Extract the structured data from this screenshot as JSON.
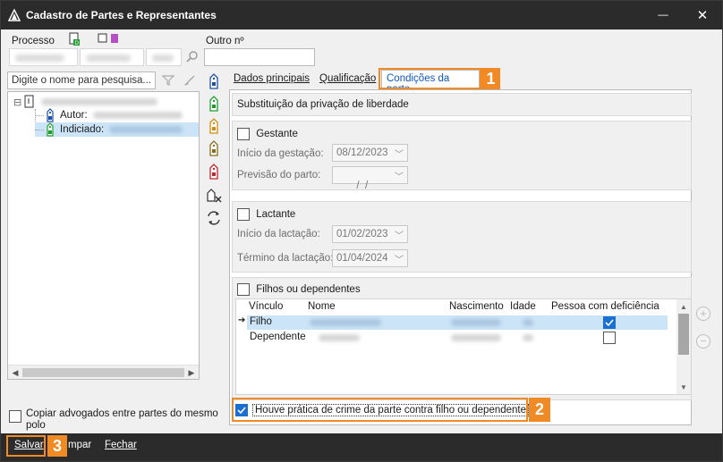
{
  "window": {
    "title": "Cadastro de Partes e Representantes",
    "minimize_glyph": "—",
    "close_glyph": "✕"
  },
  "process": {
    "processo_label": "Processo",
    "outro_label": "Outro nº"
  },
  "search": {
    "placeholder": "Digite o nome para pesquisa..."
  },
  "tree": {
    "collapse_glyph": "⊟",
    "autor_label": "Autor:",
    "indiciado_label": "Indiciado:"
  },
  "tabs": [
    {
      "label": "Dados principais"
    },
    {
      "label": "Qualificação"
    },
    {
      "label": "Condições da parte"
    }
  ],
  "callouts": [
    "1",
    "2",
    "3"
  ],
  "conditions": {
    "section_title": "Substituição da privação de liberdade",
    "gestante": {
      "label": "Gestante",
      "inicio_label": "Início da gestação:",
      "inicio_value": "08/12/2023",
      "previsao_label": "Previsão do parto:",
      "previsao_value": " /  /"
    },
    "lactante": {
      "label": "Lactante",
      "inicio_label": "Início da lactação:",
      "inicio_value": "01/02/2023",
      "termino_label": "Término da lactação:",
      "termino_value": "01/04/2024"
    },
    "filhos": {
      "label": "Filhos ou dependentes",
      "columns": [
        "Vínculo",
        "Nome",
        "Nascimento",
        "Idade",
        "Pessoa com deficiência"
      ],
      "rows": [
        {
          "vinculo": "Filho",
          "deficiencia": true,
          "selected": true
        },
        {
          "vinculo": "Dependente",
          "deficiencia": false,
          "selected": false
        }
      ]
    },
    "crime_label": "Houve prática de crime da parte contra filho ou dependente"
  },
  "copy_lawyers_label": "Copiar advogados entre partes do mesmo polo",
  "footer": {
    "salvar": "Salvar",
    "limpar": "mpar",
    "fechar": "Fechar"
  },
  "colors": {
    "accent_orange": "#f08a24",
    "selection_blue": "#cce4f7",
    "checkbox_blue": "#1a6fd0",
    "tab_active_text": "#0b57c2"
  }
}
